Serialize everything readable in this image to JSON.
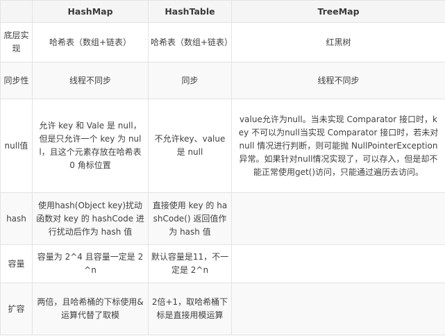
{
  "headers": [
    "",
    "HashMap",
    "HashTable",
    "TreeMap"
  ],
  "rows": [
    {
      "label": "底层实现",
      "hashmap": "哈希表（数组+链表）",
      "hashtable": "哈希表（数组+链表）",
      "treemap": "红黑树"
    },
    {
      "label": "同步性",
      "hashmap": "线程不同步",
      "hashtable": "同步",
      "treemap": "线程不同步"
    },
    {
      "label": "null值",
      "hashmap": "允许 key 和 Vale 是 null，但是只允许一个 key 为 null，且这个元素存放在哈希表 0 角标位置",
      "hashtable": "不允许key、value 是 null",
      "treemap": "value允许为null。当未实现 Comparator 接口时，key 不可以为null当实现 Comparator 接口时，若未对 null 情况进行判断，则可能抛 NullPointerException 异常。如果针对null情况实现了，可以存入，但是却不能正常使用get()访问，只能通过遍历去访问。"
    },
    {
      "label": "hash",
      "hashmap": "使用hash(Object key)扰动函数对 key 的 hashCode 进行扰动后作为 hash 值",
      "hashtable": "直接使用 key 的 hashCode() 返回值作为 hash 值",
      "treemap": ""
    },
    {
      "label": "容量",
      "hashmap": "容量为 2^4 且容量一定是 2^n",
      "hashtable": "默认容量是11，不一定是 2^n",
      "treemap": ""
    },
    {
      "label": "扩容",
      "hashmap": "两倍，且哈希桶的下标使用&运算代替了取模",
      "hashtable": "2倍+1，取哈希桶下标是直接用模运算",
      "treemap": ""
    }
  ]
}
